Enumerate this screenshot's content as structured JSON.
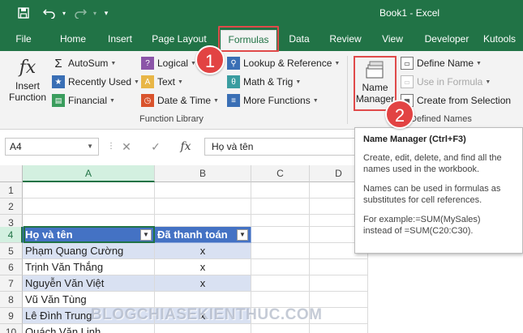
{
  "titlebar": {
    "title": "Book1  -  Excel",
    "bg": "#217346"
  },
  "tabs": [
    {
      "label": "File"
    },
    {
      "label": "Home"
    },
    {
      "label": "Insert"
    },
    {
      "label": "Page Layout"
    },
    {
      "label": "Formulas",
      "active": true
    },
    {
      "label": "Data"
    },
    {
      "label": "Review"
    },
    {
      "label": "View"
    },
    {
      "label": "Developer"
    },
    {
      "label": "Kutools"
    }
  ],
  "ribbon": {
    "insert_function": {
      "line1": "Insert",
      "line2": "Function",
      "icon": "fx"
    },
    "library": {
      "autosum": "AutoSum",
      "recently_used": "Recently Used",
      "financial": "Financial",
      "logical": "Logical",
      "text": "Text",
      "date_time": "Date & Time",
      "lookup": "Lookup & Reference",
      "math": "Math & Trig",
      "more": "More Functions",
      "group_label": "Function Library"
    },
    "names": {
      "name_manager_line1": "Name",
      "name_manager_line2": "Manager",
      "define_name": "Define Name",
      "use_in_formula": "Use in Formula",
      "create_from_selection": "Create from Selection",
      "group_label": "Defined Names"
    }
  },
  "badges": [
    "1",
    "2"
  ],
  "formula_bar": {
    "namebox": "A4",
    "cancel": "✕",
    "enter": "✓",
    "fx": "fx",
    "value": "Họ và tên"
  },
  "grid": {
    "columns": [
      "A",
      "B",
      "C",
      "D"
    ],
    "rows": [
      "1",
      "2",
      "3",
      "4",
      "5",
      "6",
      "7",
      "8",
      "9",
      "10"
    ],
    "table": {
      "headers": [
        "Họ và tên",
        "Đã thanh toán"
      ],
      "rows": [
        [
          "Phạm Quang Cường",
          "x"
        ],
        [
          "Trịnh Văn Thắng",
          "x"
        ],
        [
          "Nguyễn Văn Việt",
          "x"
        ],
        [
          "Vũ Văn Tùng",
          ""
        ],
        [
          "Lê Đình Trung",
          "x"
        ],
        [
          "Quách Văn Linh",
          ""
        ]
      ]
    }
  },
  "tooltip": {
    "title": "Name Manager (Ctrl+F3)",
    "p1": "Create, edit, delete, and find all the names used in the workbook.",
    "p2": "Names can be used in formulas as substitutes for cell references.",
    "p3a": "For example:=SUM(MySales)",
    "p3b": "instead of =SUM(C20:C30)."
  },
  "watermark": "BLOGCHIASEKIENTHUC.COM"
}
